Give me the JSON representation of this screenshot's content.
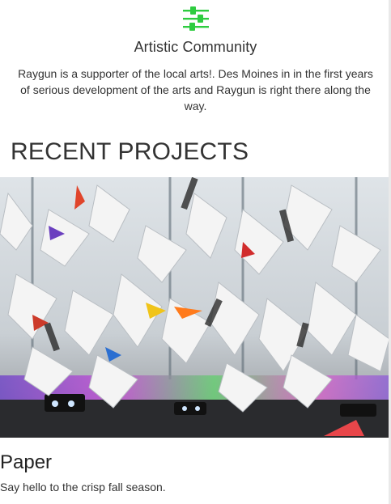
{
  "feature": {
    "icon": "sliders-icon",
    "accent_color": "#2ecc40",
    "title": "Artistic Community",
    "text": "Raygun is a supporter of the local arts!. Des Moines in in the first years of serious development of the arts and Raygun is right there along the way."
  },
  "section": {
    "heading": "RECENT PROJECTS"
  },
  "project": {
    "image": "paper-cranes-art-installation-photo",
    "title": "Paper",
    "description": "Say hello to the crisp fall season."
  }
}
